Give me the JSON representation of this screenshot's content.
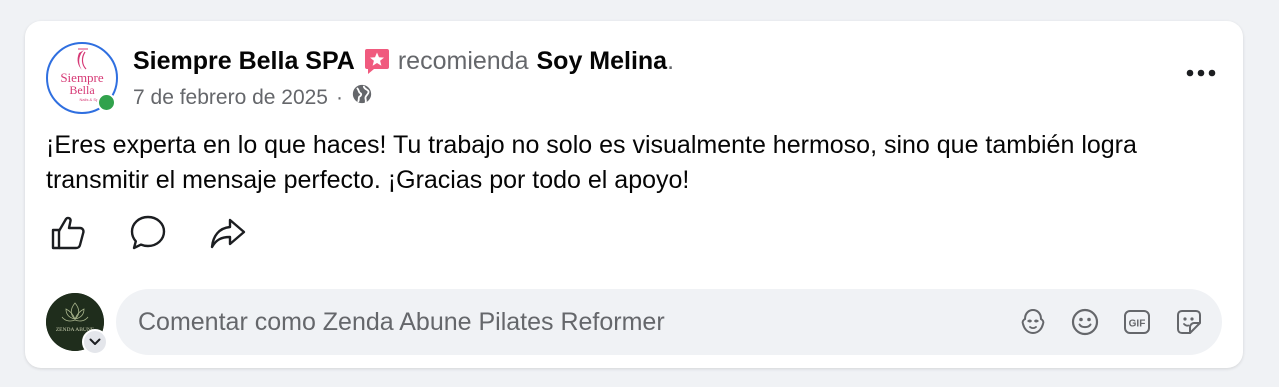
{
  "post": {
    "author": "Siempre Bella SPA",
    "verb": "recomienda",
    "target": "Soy Melina",
    "period": ".",
    "date": "7 de febrero de 2025",
    "separator": "·",
    "text": "¡Eres experta en lo que haces! Tu trabajo no solo es visualmente hermoso, sino que también logra transmitir el mensaje perfecto. ¡Gracias por todo el apoyo!",
    "avatar": {
      "logo_line1": "Siempre",
      "logo_line2": "Bella",
      "logo_tag": "Nails & Spa"
    },
    "privacy_icon": "globe-icon",
    "badge_icon": "recommend-star-icon"
  },
  "actions": {
    "like_icon": "thumbs-up-icon",
    "comment_icon": "comment-bubble-icon",
    "share_icon": "share-arrow-icon"
  },
  "comment": {
    "placeholder": "Comentar como Zenda Abune Pilates Reformer",
    "commenter_logo_text": "ZENDA ABUNE",
    "tools": [
      "avatar-sticker-icon",
      "emoji-icon",
      "gif-icon",
      "sticker-icon"
    ]
  },
  "colors": {
    "accent_pink": "#e0245e",
    "online_green": "#31a24c",
    "secondary_text": "#65676b",
    "badge_red": "#f05a7e"
  }
}
